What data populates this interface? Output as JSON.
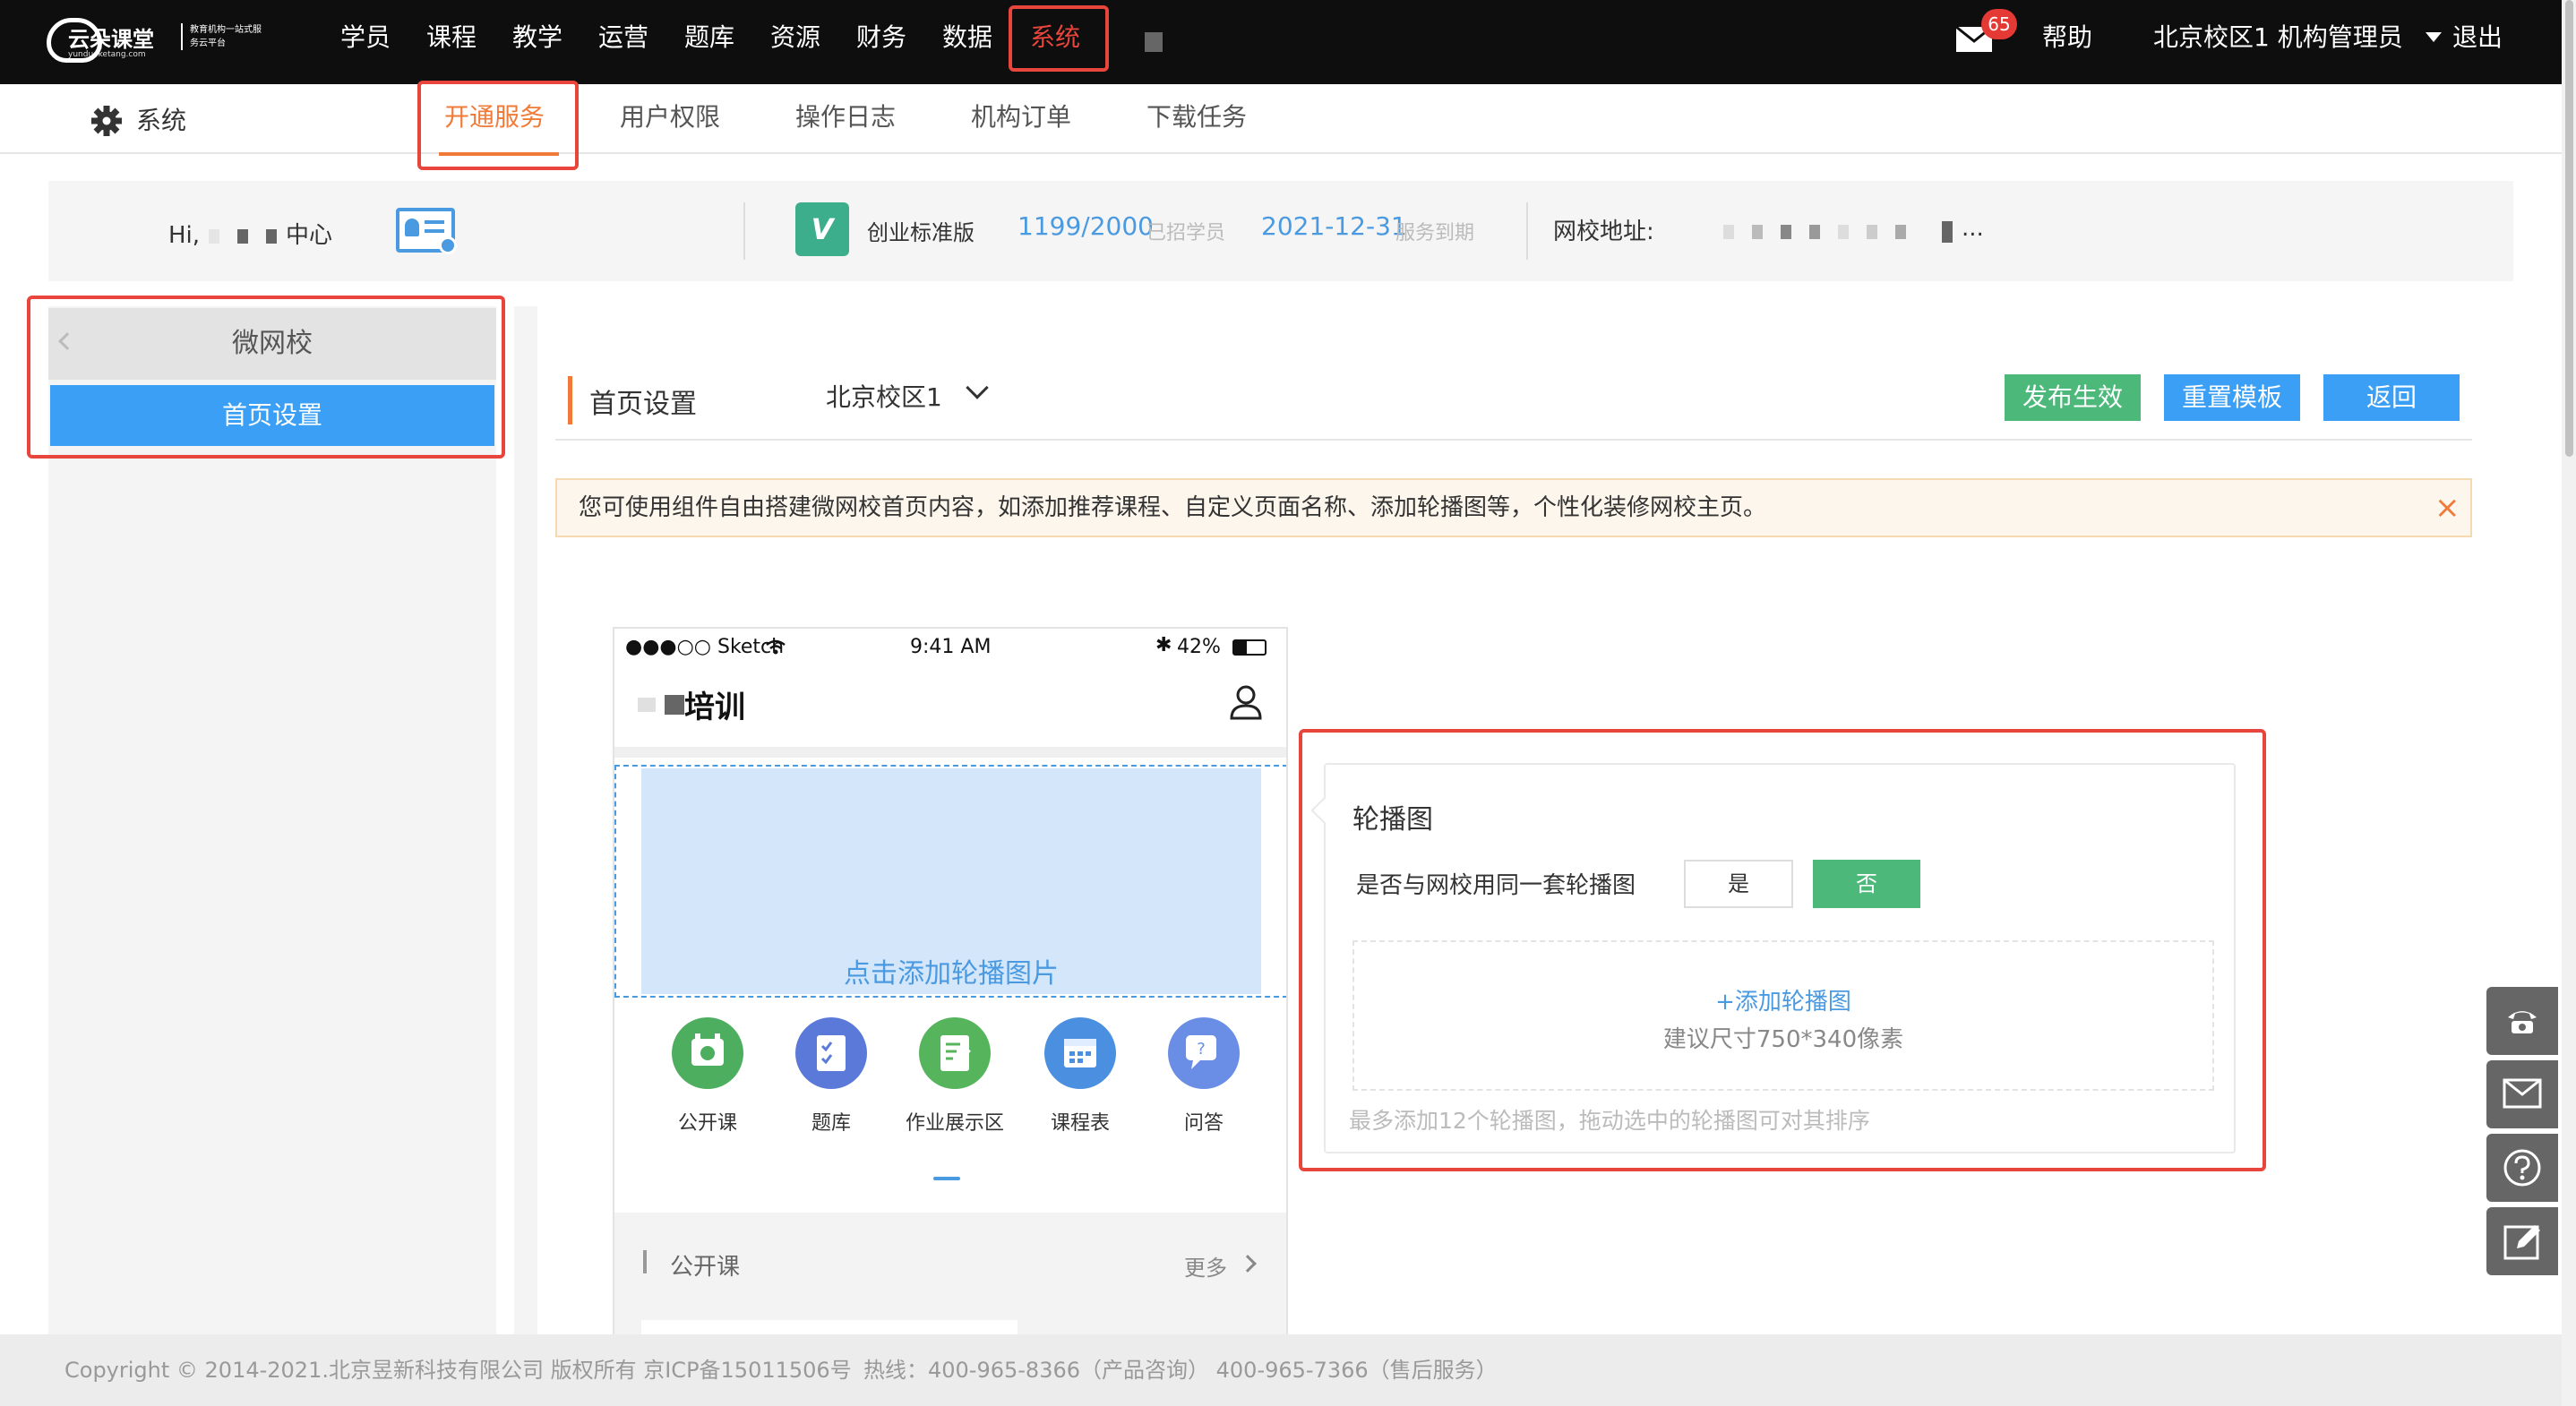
{
  "header": {
    "logo_name": "云朵课堂",
    "logo_sub": "yunduoketang.com",
    "logo_slogan": "教育机构一站式服务云平台",
    "nav": [
      "学员",
      "课程",
      "教学",
      "运营",
      "题库",
      "资源",
      "财务",
      "数据",
      "系统"
    ],
    "active_nav": "系统",
    "mail_badge": "65",
    "help": "帮助",
    "account": "北京校区1 机构管理员",
    "logout": "退出"
  },
  "subnav": {
    "section_title": "系统",
    "tabs": [
      "开通服务",
      "用户权限",
      "操作日志",
      "机构订单",
      "下载任务"
    ],
    "active_tab": "开通服务"
  },
  "info": {
    "greeting": "Hi,",
    "greeting_tail": "中心",
    "edition": "创业标准版",
    "student_count": "1199/2000",
    "student_count_label": "已招学员",
    "expire_date": "2021-12-31",
    "expire_label": "服务到期",
    "school_url_label": "网校地址:",
    "school_url_tail": "..."
  },
  "sidebar": {
    "group_title": "微网校",
    "items": [
      "首页设置"
    ]
  },
  "main": {
    "page_title": "首页设置",
    "campus_select": "北京校区1",
    "buttons": {
      "publish": "发布生效",
      "reset": "重置模板",
      "back": "返回"
    },
    "notice": "您可使用组件自由搭建微网校首页内容，如添加推荐课程、自定义页面名称、添加轮播图等，个性化装修网校主页。"
  },
  "phone": {
    "carrier": "●●●○○ Sketch",
    "time": "9:41 AM",
    "battery": "42%",
    "title_tail": "培训",
    "banner_placeholder": "点击添加轮播图片",
    "icons": [
      {
        "label": "公开课",
        "color": "#4cae5e",
        "icon": "video-icon"
      },
      {
        "label": "题库",
        "color": "#5b79d9",
        "icon": "question-bank-icon"
      },
      {
        "label": "作业展示区",
        "color": "#55b45c",
        "icon": "homework-icon"
      },
      {
        "label": "课程表",
        "color": "#4a8fe0",
        "icon": "calendar-icon"
      },
      {
        "label": "问答",
        "color": "#6a8de6",
        "icon": "qa-icon"
      }
    ],
    "section_title": "公开课",
    "more": "更多"
  },
  "carousel_panel": {
    "title": "轮播图",
    "same_question": "是否与网校用同一套轮播图",
    "yes": "是",
    "no": "否",
    "selected": "否",
    "add_label": "+添加轮播图",
    "size_hint": "建议尺寸750*340像素",
    "limit_hint": "最多添加12个轮播图，拖动选中的轮播图可对其排序"
  },
  "footer": {
    "copyright": "Copyright © 2014-2021.北京昱新科技有限公司 版权所有 京ICP备15011506号",
    "hotline": "热线：400-965-8366（产品咨询） 400-965-7366（售后服务）"
  },
  "colors": {
    "accent": "#e8453c",
    "primary_blue": "#3a9ff5",
    "green": "#4cb97b",
    "orange_tab": "#f07b39"
  }
}
